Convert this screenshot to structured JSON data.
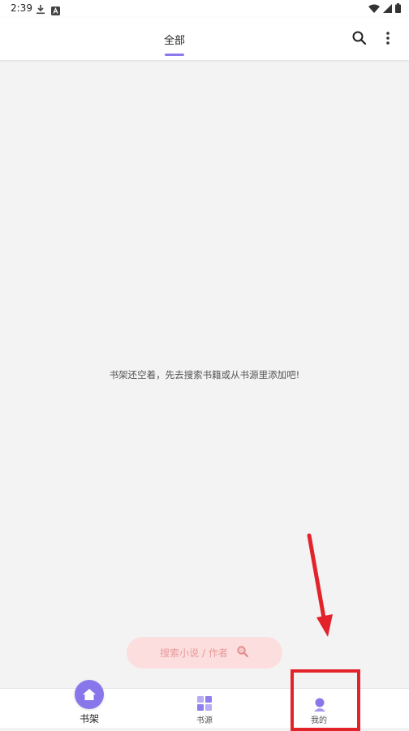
{
  "status_bar": {
    "time": "2:39"
  },
  "top_bar": {
    "tab_label": "全部"
  },
  "empty_state": {
    "message": "书架还空着，先去搜索书籍或从书源里添加吧!"
  },
  "search_pill": {
    "label": "搜索小说 / 作者"
  },
  "bottom_nav": {
    "items": [
      {
        "label": "书架",
        "icon": "home-icon",
        "active": true
      },
      {
        "label": "书源",
        "icon": "grid-icon",
        "active": false
      },
      {
        "label": "我的",
        "icon": "user-icon",
        "active": false
      }
    ]
  },
  "colors": {
    "accent": "#8a78ee",
    "pill_bg": "#fcdede",
    "pill_text": "#e79a9a",
    "annotation": "#e3232a",
    "background": "#f3f3f4"
  }
}
